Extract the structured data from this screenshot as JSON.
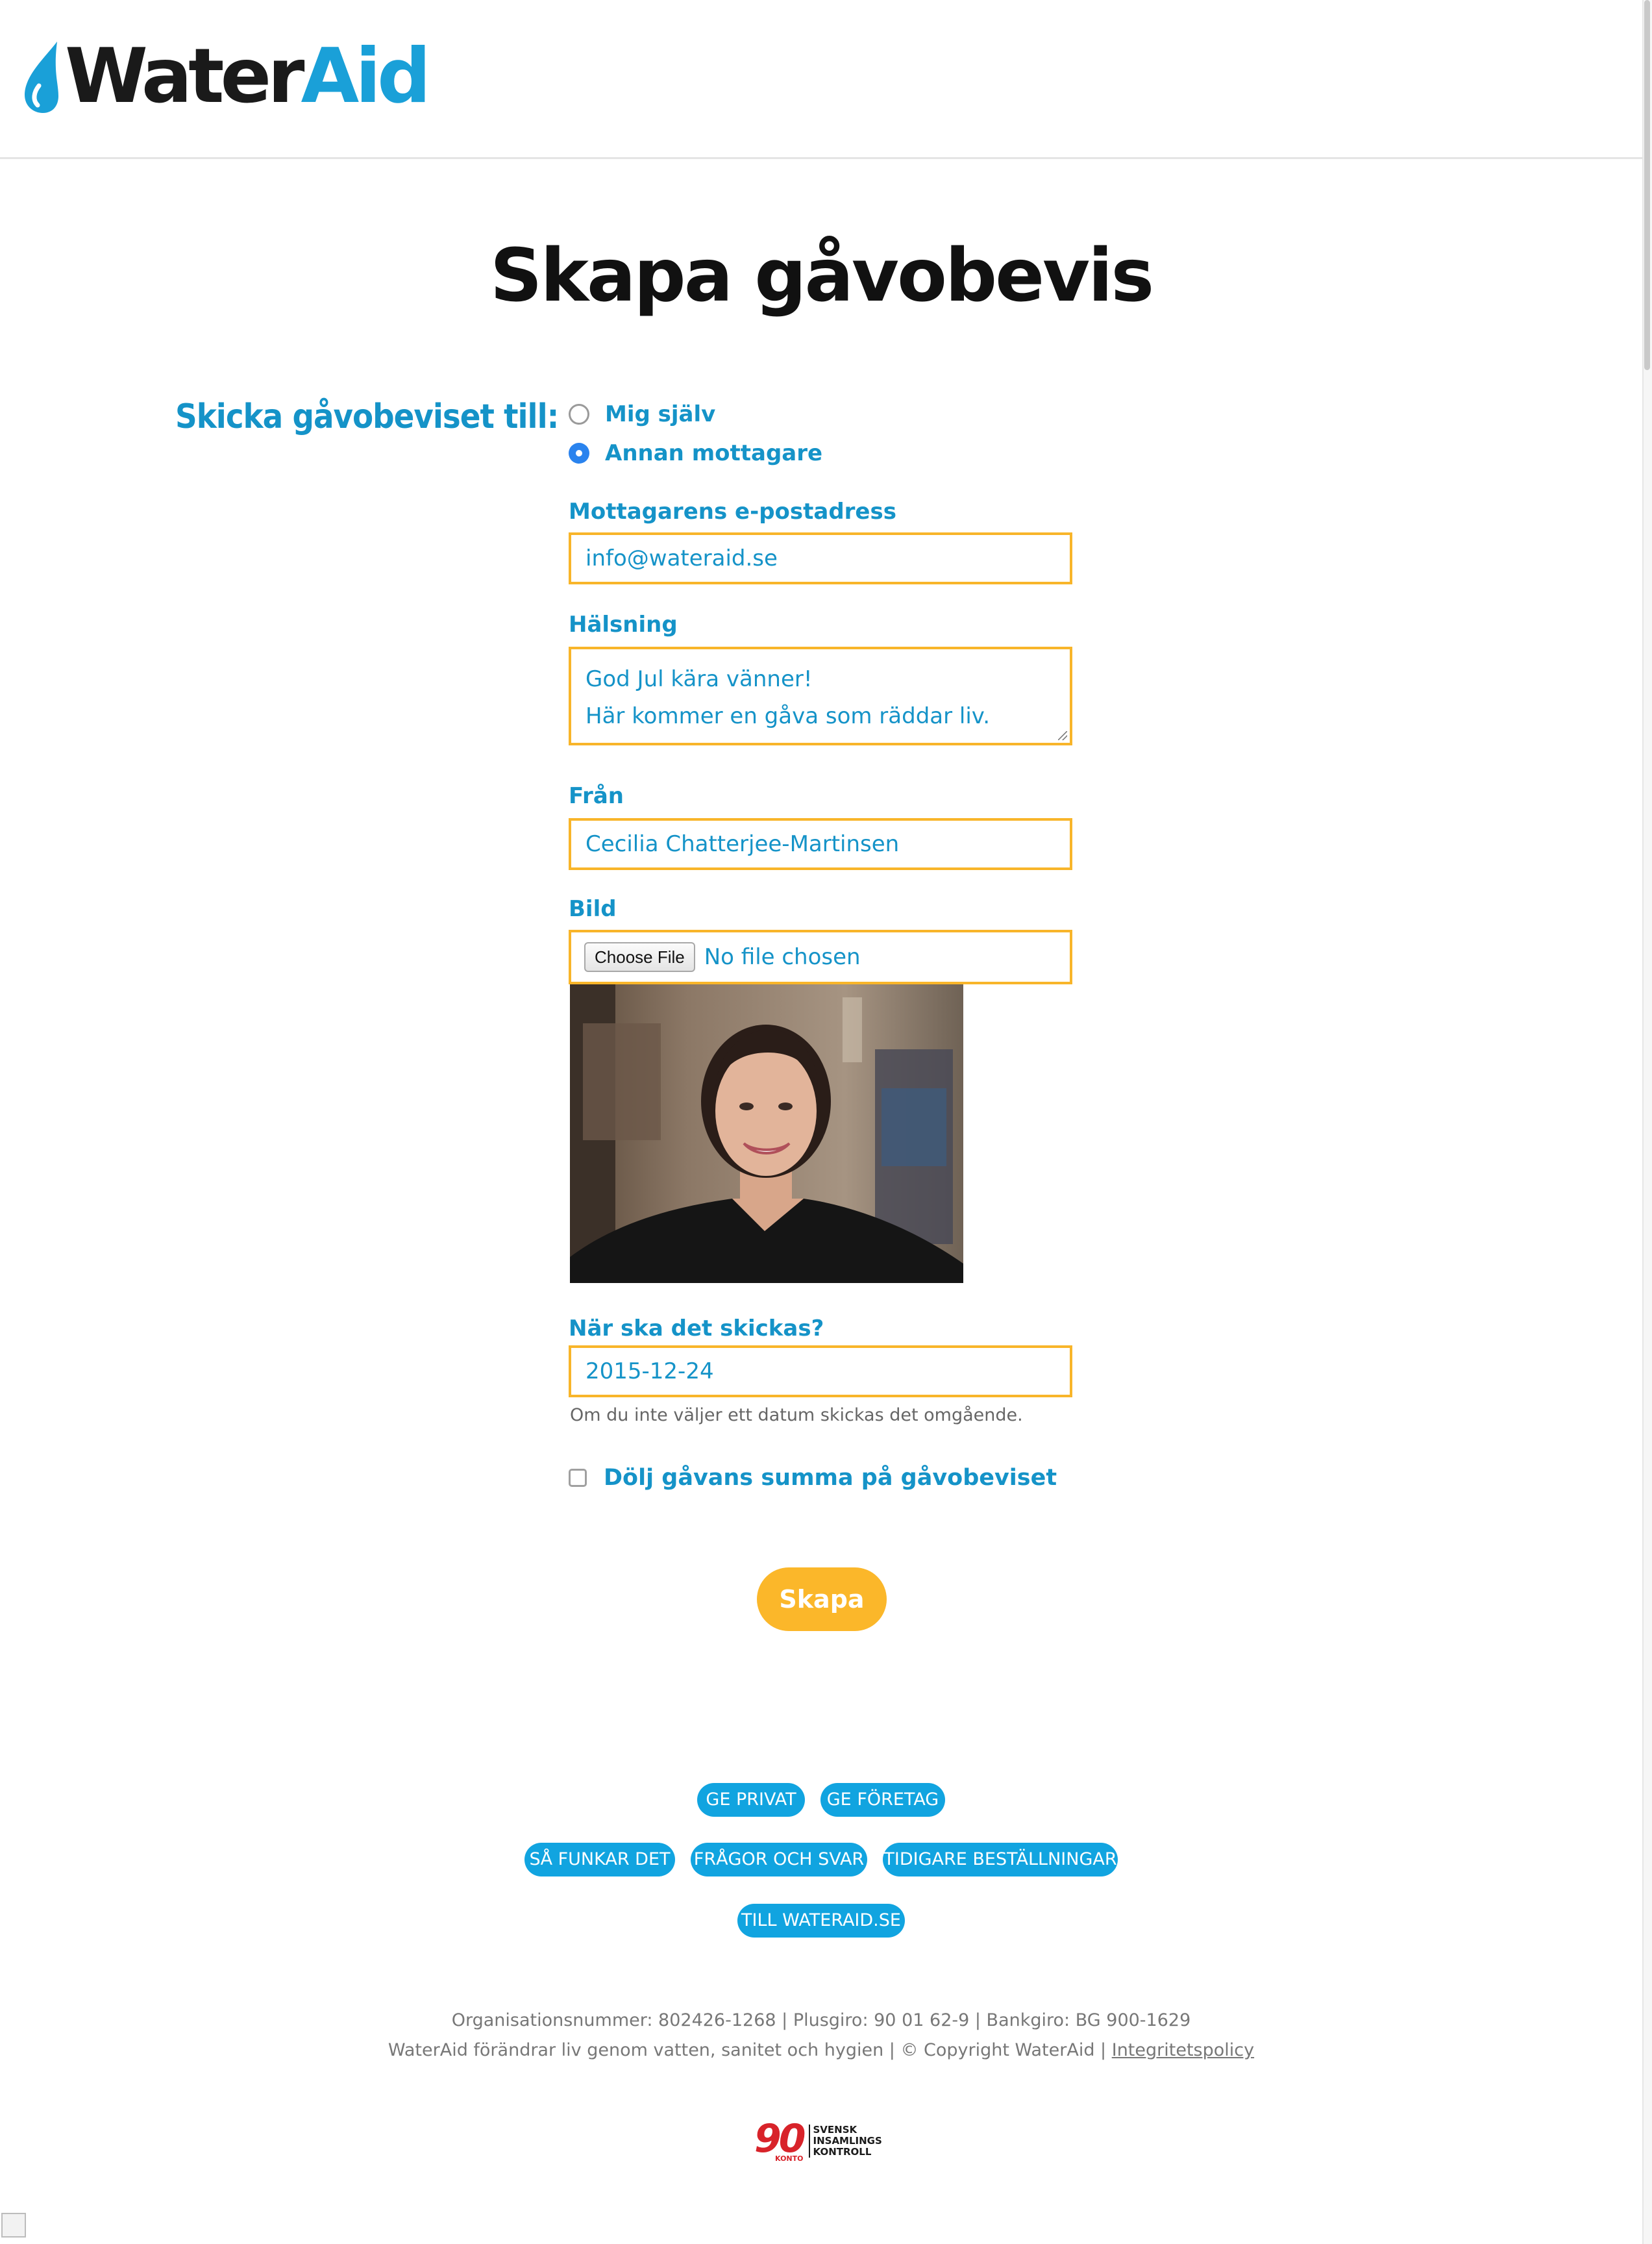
{
  "header": {
    "logo_part1": "Water",
    "logo_part2": "Aid",
    "brand_color": "#1aa0d8"
  },
  "page_title": "Skapa gåvobevis",
  "form": {
    "send_to_label": "Skicka gåvobeviset till:",
    "recipient_options": [
      {
        "label": "Mig själv",
        "checked": false
      },
      {
        "label": "Annan mottagare",
        "checked": true
      }
    ],
    "email_label": "Mottagarens e-postadress",
    "email_value": "info@wateraid.se",
    "greeting_label": "Hälsning",
    "greeting_line1": "God Jul kära vänner!",
    "greeting_line2": "Här kommer en gåva som räddar liv.",
    "from_label": "Från",
    "from_value": "Cecilia Chatterjee-Martinsen",
    "image_label": "Bild",
    "choose_file_label": "Choose File",
    "file_status": "No file chosen",
    "date_label": "När ska det skickas?",
    "date_value": "2015-12-24",
    "date_hint": "Om du inte väljer ett datum skickas det omgående.",
    "hide_amount_label": "Dölj gåvans summa på gåvobeviset",
    "hide_amount_checked": false,
    "submit_label": "Skapa",
    "accent_color": "#f8b52a",
    "label_color": "#1593c8"
  },
  "footer": {
    "nav": [
      "GE PRIVAT",
      "GE FÖRETAG",
      "SÅ FUNKAR DET",
      "FRÅGOR OCH SVAR",
      "TIDIGARE BESTÄLLNINGAR",
      "TILL WATERAID.SE"
    ],
    "org_line": "Organisationsnummer: 802426-1268 | Plusgiro: 90 01 62-9 | Bankgiro: BG 900-1629",
    "tagline": "WaterAid förändrar liv genom vatten, sanitet och hygien | © Copyright WaterAid | ",
    "privacy_link": "Integritetspolicy",
    "badge": {
      "number": "90",
      "konto": "KONTO",
      "line1": "SVENSK",
      "line2": "INSAMLINGS",
      "line3": "KONTROLL"
    }
  }
}
